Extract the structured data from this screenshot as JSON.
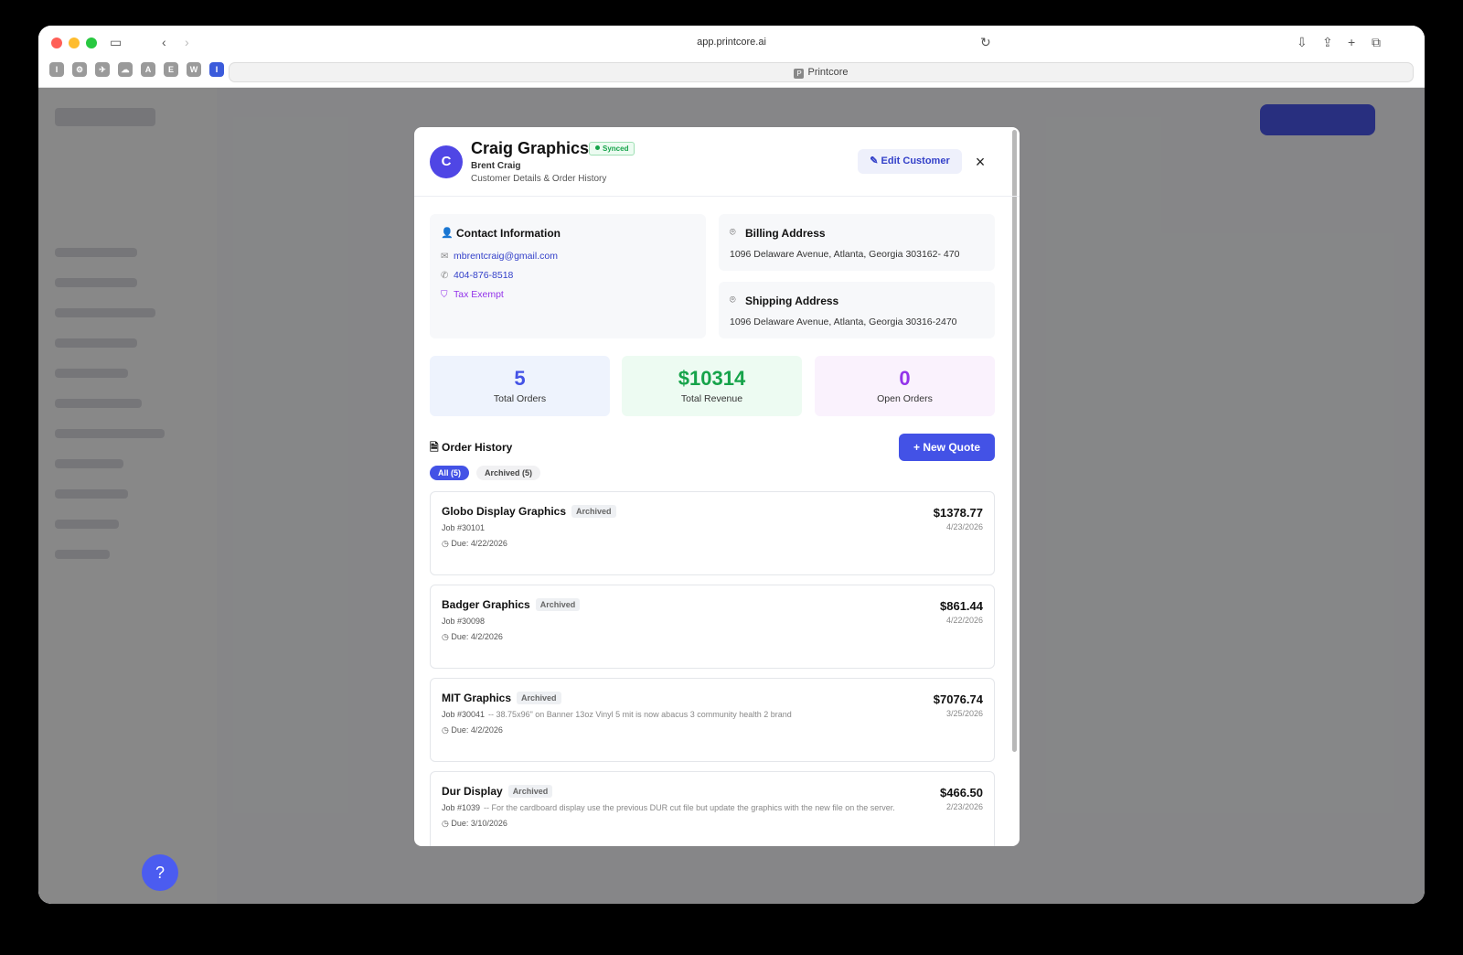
{
  "browser": {
    "url": "app.printcore.ai",
    "tab_title": "Printcore",
    "tab_fav": "P",
    "favorites": [
      "I",
      "⚙",
      "✈",
      "☁",
      "A",
      "E",
      "W",
      "I"
    ]
  },
  "modal": {
    "avatar_letter": "C",
    "company": "Craig Graphics",
    "synced_label": "Synced",
    "person": "Brent Craig",
    "subtitle": "Customer Details & Order History",
    "edit_label": "Edit Customer",
    "close_icon": "×",
    "contact": {
      "title": "Contact Information",
      "email": "mbrentcraig@gmail.com",
      "phone": "404-876-8518",
      "tax": "Tax Exempt"
    },
    "billing": {
      "title": "Billing Address",
      "address": "1096 Delaware Avenue, Atlanta, Georgia 303162- 470"
    },
    "shipping": {
      "title": "Shipping Address",
      "address": "1096 Delaware Avenue, Atlanta, Georgia 30316-2470"
    },
    "stats": [
      {
        "value": "5",
        "label": "Total Orders",
        "color": "#4352e6"
      },
      {
        "value": "$10314",
        "label": "Total Revenue",
        "color": "#16a34a"
      },
      {
        "value": "0",
        "label": "Open Orders",
        "color": "#9333ea"
      }
    ],
    "order_history": {
      "title": "Order History",
      "new_quote": "New Quote",
      "filter_all": "All (5)",
      "filter_archived": "Archived (5)",
      "orders": [
        {
          "name": "Globo Display Graphics",
          "badge": "Archived",
          "job": "Job #30101",
          "note": "",
          "due": "Due: 4/22/2026",
          "amount": "$1378.77",
          "date": "4/23/2026"
        },
        {
          "name": "Badger Graphics",
          "badge": "Archived",
          "job": "Job #30098",
          "note": "",
          "due": "Due: 4/2/2026",
          "amount": "$861.44",
          "date": "4/22/2026"
        },
        {
          "name": "MIT Graphics",
          "badge": "Archived",
          "job": "Job #30041",
          "note": "-- 38.75x96\" on Banner 13oz Vinyl 5 mit is now abacus 3 community health 2 brand",
          "due": "Due: 4/2/2026",
          "amount": "$7076.74",
          "date": "3/25/2026"
        },
        {
          "name": "Dur Display",
          "badge": "Archived",
          "job": "Job #1039",
          "note": "-- For the cardboard display use the previous DUR cut file but update the graphics with the new file on the server.",
          "due": "Due: 3/10/2026",
          "amount": "$466.50",
          "date": "2/23/2026"
        }
      ]
    }
  },
  "help_icon": "?"
}
